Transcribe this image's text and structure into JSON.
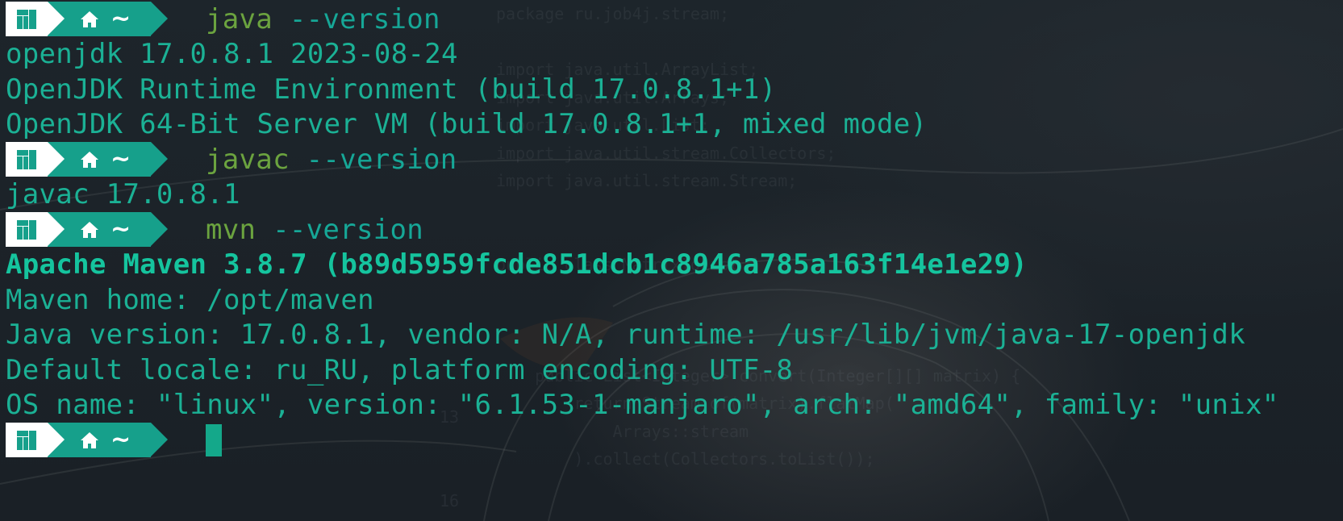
{
  "terminal": {
    "prompt_dir": "~",
    "commands": {
      "java": {
        "name": "java",
        "args": "--version"
      },
      "javac": {
        "name": "javac",
        "args": "--version"
      },
      "mvn": {
        "name": "mvn",
        "args": "--version"
      }
    },
    "java_output": [
      "openjdk 17.0.8.1 2023-08-24",
      "OpenJDK Runtime Environment (build 17.0.8.1+1)",
      "OpenJDK 64-Bit Server VM (build 17.0.8.1+1, mixed mode)"
    ],
    "javac_output": [
      "javac 17.0.8.1"
    ],
    "mvn_output": [
      "Apache Maven 3.8.7 (b89d5959fcde851dcb1c8946a785a163f14e1e29)",
      "Maven home: /opt/maven",
      "Java version: 17.0.8.1, vendor: N/A, runtime: /usr/lib/jvm/java-17-openjdk",
      "Default locale: ru_RU, platform encoding: UTF-8",
      "OS name: \"linux\", version: \"6.1.53-1-manjaro\", arch: \"amd64\", family: \"unix\""
    ]
  },
  "background": {
    "code_lines": [
      "package ru.job4j.stream;",
      "",
      "import java.util.ArrayList;",
      "import java.util.Arrays;",
      "import java.util.List;",
      "import java.util.stream.Collectors;",
      "import java.util.stream.Stream;",
      "",
      "",
      "public class MatrixToList {",
      "",
      "",
      "",
      "    public List<Integer> convert(Integer[][] matrix) {",
      "        return Stream.of(matrix).flatMap(",
      "            Arrays::stream",
      "        ).collect(Collectors.toList());"
    ],
    "line_numbers": [
      "13",
      "",
      "",
      "16"
    ]
  },
  "colors": {
    "background": "#1c2329",
    "output_text": "#1bb195",
    "command_name": "#6ba33f",
    "command_args": "#16a797",
    "prompt_accent": "#16a08b",
    "prompt_logo_bg": "#ffffff",
    "cursor": "#14a88a"
  },
  "icons": {
    "prompt_logo": "manjaro-logo-icon",
    "home": "home-icon"
  }
}
